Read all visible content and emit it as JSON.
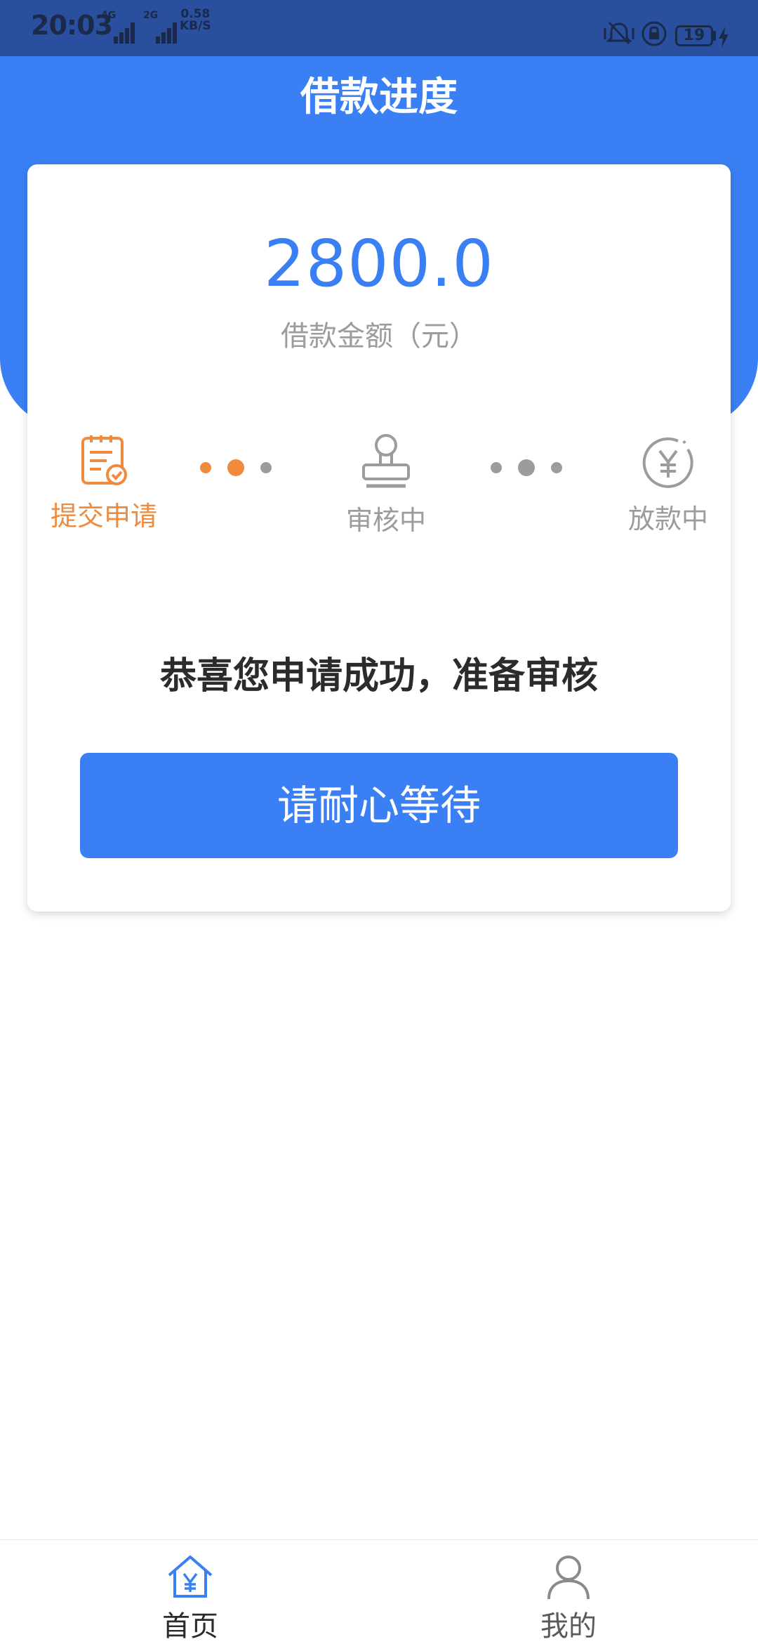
{
  "status_bar": {
    "time": "20:03",
    "signal1_label": "4G",
    "signal2_label": "2G",
    "net_speed_value": "0.58",
    "net_speed_unit": "KB/S",
    "battery": "19"
  },
  "header": {
    "title": "借款进度"
  },
  "loan": {
    "amount": "2800.0",
    "amount_label": "借款金额（元）"
  },
  "steps": [
    {
      "label": "提交申请",
      "icon": "document-check-icon",
      "active": true
    },
    {
      "label": "审核中",
      "icon": "stamp-icon",
      "active": false
    },
    {
      "label": "放款中",
      "icon": "yuan-coin-icon",
      "active": false
    }
  ],
  "message": "恭喜您申请成功，准备审核",
  "button_label": "请耐心等待",
  "tabs": [
    {
      "label": "首页",
      "icon": "home-yuan-icon",
      "active": true
    },
    {
      "label": "我的",
      "icon": "user-icon",
      "active": false
    }
  ],
  "colors": {
    "brand_blue": "#3a80f4",
    "active_orange": "#f08a3c",
    "inactive_gray": "#9c9c9c",
    "status_bar": "#2a4f9e"
  }
}
